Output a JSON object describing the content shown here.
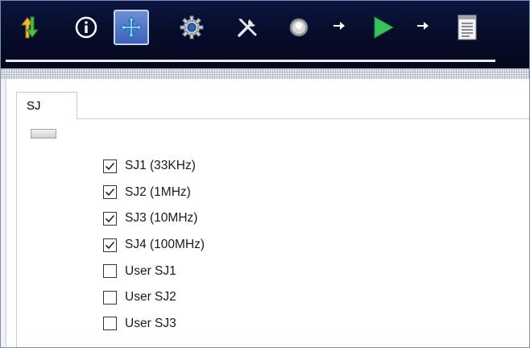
{
  "toolbar": {
    "buttons": [
      {
        "icon": "download-arrows-icon"
      },
      {
        "icon": "info-icon"
      },
      {
        "icon": "move-crosshair-icon",
        "active": true
      },
      {
        "icon": "gear-icon"
      },
      {
        "icon": "tools-icon"
      },
      {
        "icon": "power-knob-icon"
      },
      {
        "icon": "play-icon"
      },
      {
        "icon": "report-icon"
      }
    ]
  },
  "tabs": [
    {
      "label": "SJ"
    }
  ],
  "checkboxes": [
    {
      "label": "SJ1 (33KHz)",
      "checked": true
    },
    {
      "label": "SJ2 (1MHz)",
      "checked": true
    },
    {
      "label": "SJ3 (10MHz)",
      "checked": true
    },
    {
      "label": "SJ4 (100MHz)",
      "checked": true
    },
    {
      "label": "User SJ1",
      "checked": false
    },
    {
      "label": "User SJ2",
      "checked": false
    },
    {
      "label": "User SJ3",
      "checked": false
    }
  ]
}
